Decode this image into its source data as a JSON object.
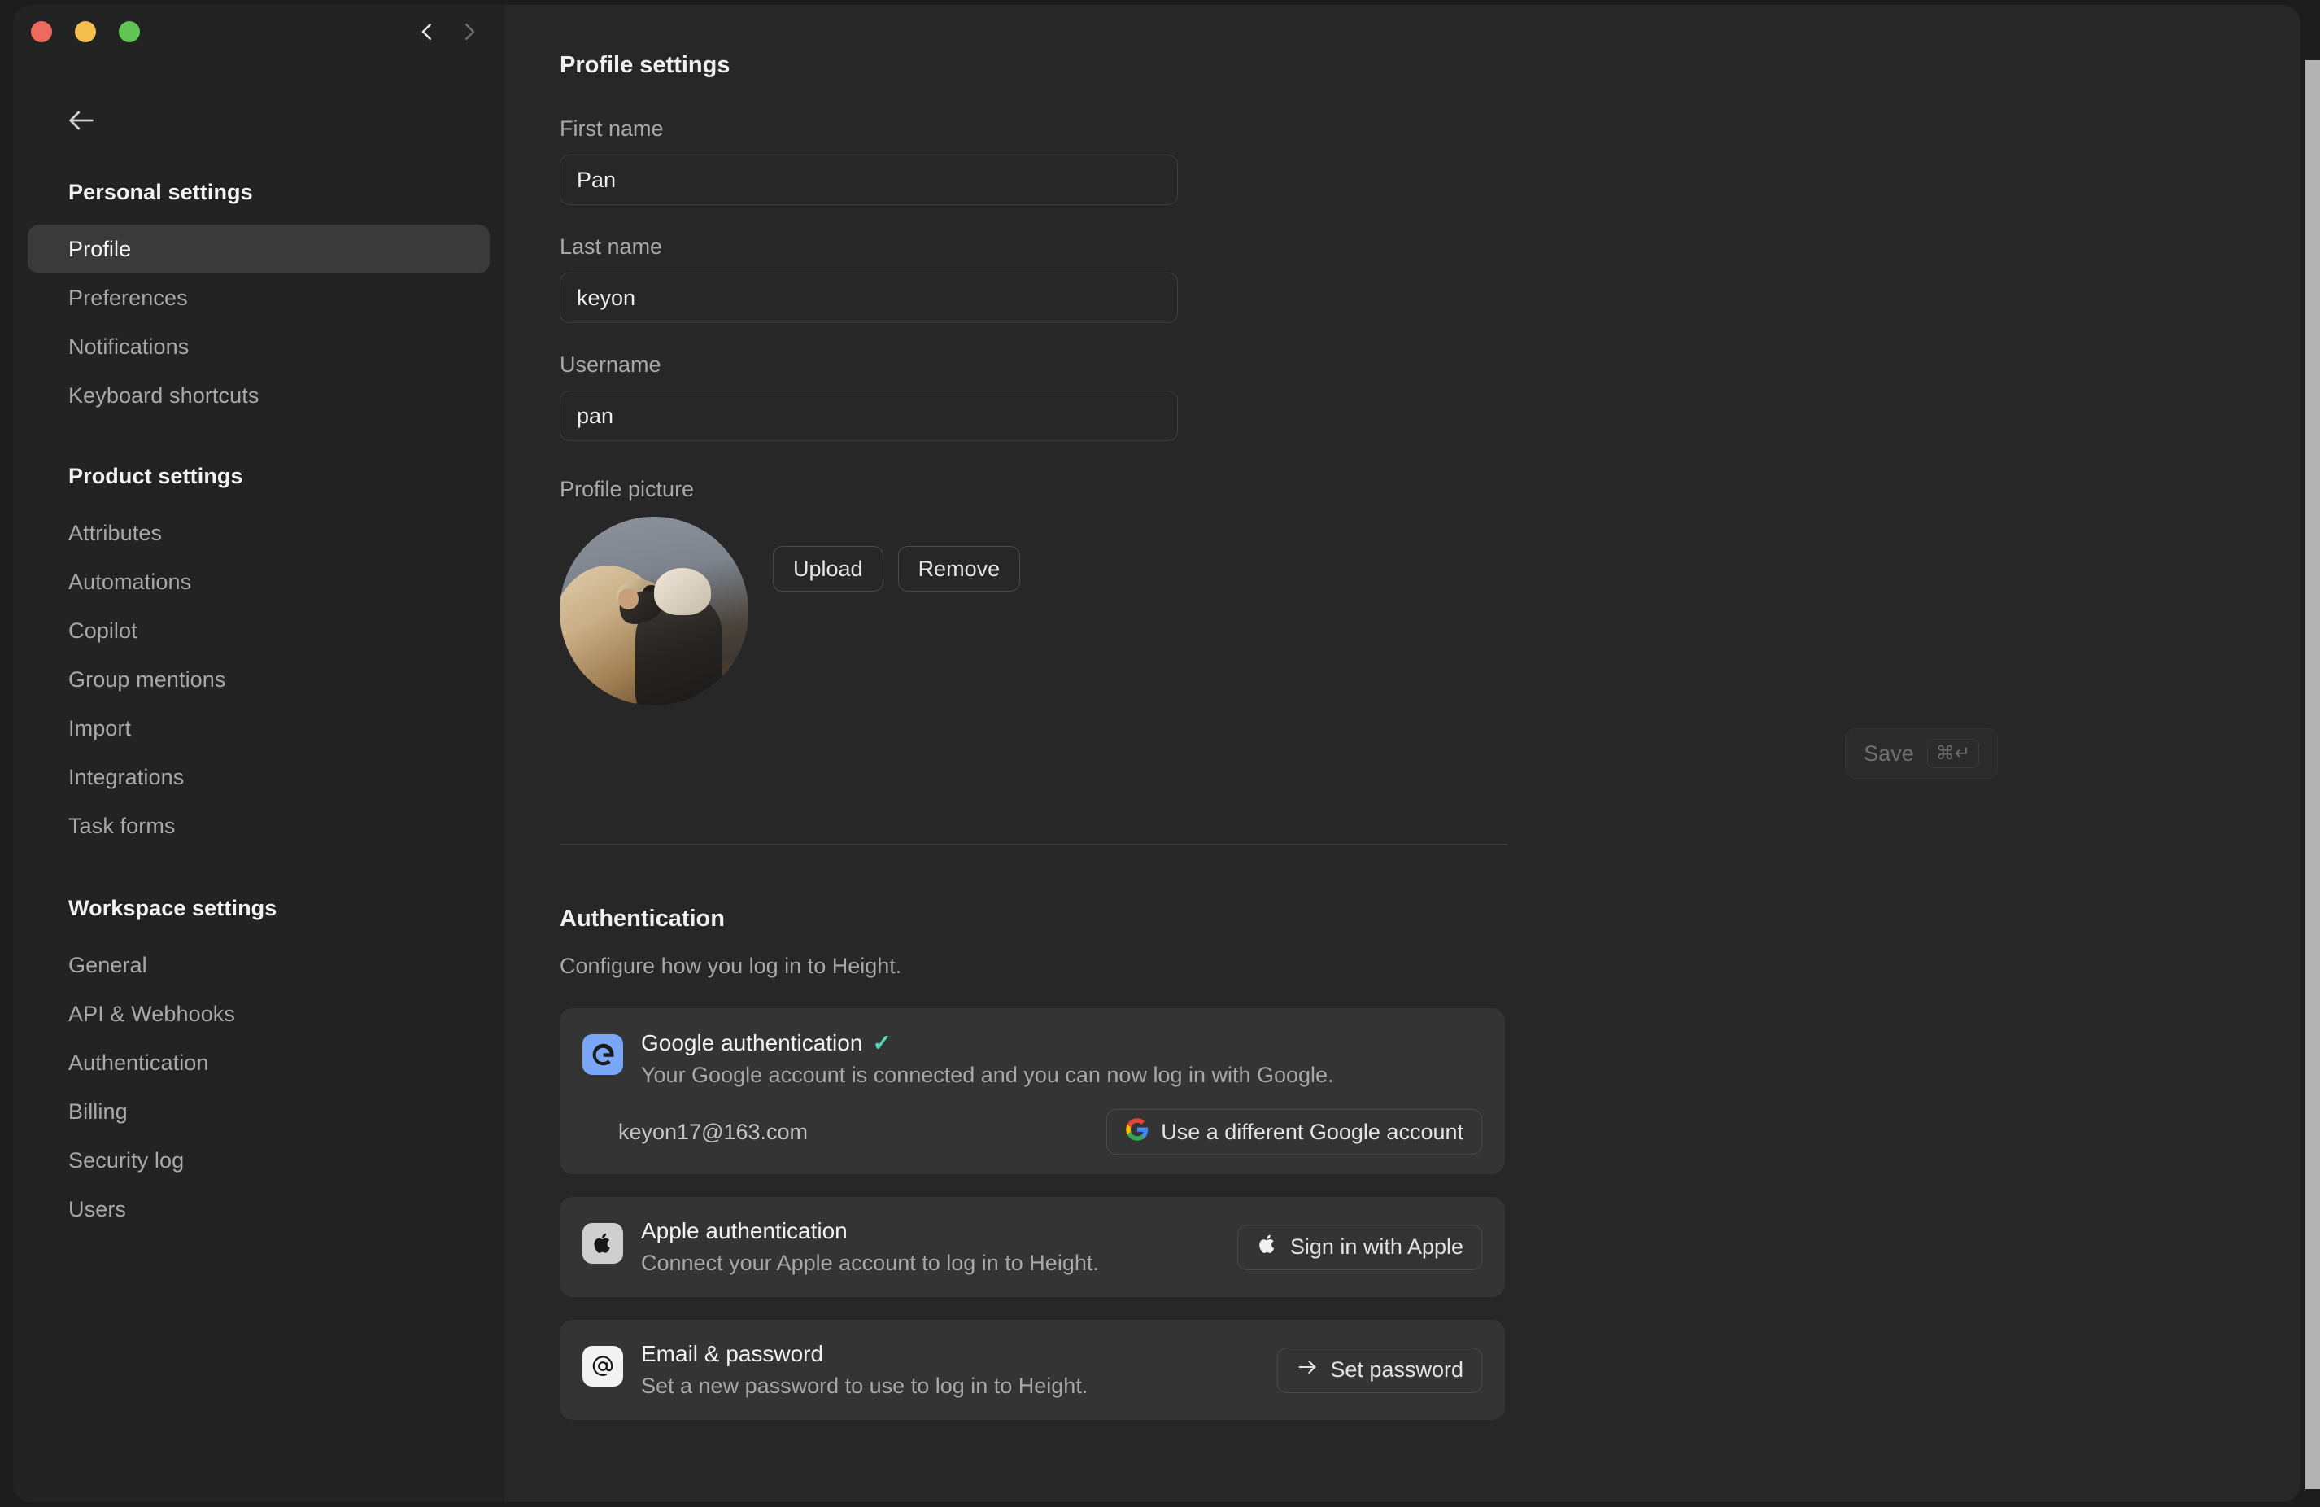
{
  "window": {
    "traffic_lights": [
      "close",
      "minimize",
      "zoom"
    ],
    "nav_back_icon": "chevron-left-icon",
    "nav_forward_icon": "chevron-right-icon",
    "back_arrow_icon": "arrow-left-icon"
  },
  "sidebar": {
    "groups": [
      {
        "title": "Personal settings",
        "items": [
          {
            "label": "Profile",
            "active": true
          },
          {
            "label": "Preferences",
            "active": false
          },
          {
            "label": "Notifications",
            "active": false
          },
          {
            "label": "Keyboard shortcuts",
            "active": false
          }
        ]
      },
      {
        "title": "Product settings",
        "items": [
          {
            "label": "Attributes",
            "active": false
          },
          {
            "label": "Automations",
            "active": false
          },
          {
            "label": "Copilot",
            "active": false
          },
          {
            "label": "Group mentions",
            "active": false
          },
          {
            "label": "Import",
            "active": false
          },
          {
            "label": "Integrations",
            "active": false
          },
          {
            "label": "Task forms",
            "active": false
          }
        ]
      },
      {
        "title": "Workspace settings",
        "items": [
          {
            "label": "General",
            "active": false
          },
          {
            "label": "API & Webhooks",
            "active": false
          },
          {
            "label": "Authentication",
            "active": false
          },
          {
            "label": "Billing",
            "active": false
          },
          {
            "label": "Security log",
            "active": false
          },
          {
            "label": "Users",
            "active": false
          }
        ]
      }
    ]
  },
  "profile": {
    "title": "Profile settings",
    "fields": [
      {
        "label": "First name",
        "value": "Pan"
      },
      {
        "label": "Last name",
        "value": "keyon"
      },
      {
        "label": "Username",
        "value": "pan"
      }
    ],
    "picture": {
      "label": "Profile picture",
      "alt": "photo of a child and a dog",
      "upload_label": "Upload",
      "remove_label": "Remove"
    },
    "save": {
      "label": "Save",
      "shortcut": "⌘↵",
      "enabled": false
    }
  },
  "authentication": {
    "title": "Authentication",
    "subtitle": "Configure how you log in to Height.",
    "cards": [
      {
        "id": "google",
        "icon": "google-g-icon",
        "icon_bg": "#7aa6f7",
        "name": "Google authentication",
        "connected": true,
        "check_glyph": "✓",
        "check_color": "#4fd7c0",
        "description": "Your Google account is connected and you can now log in with Google.",
        "email": "keyon17@163.com",
        "action_label": "Use a different Google account",
        "action_icon": "google-color-icon"
      },
      {
        "id": "apple",
        "icon": "apple-icon",
        "icon_bg": "#cfcfcf",
        "name": "Apple authentication",
        "connected": false,
        "description": "Connect your Apple account to log in to Height.",
        "action_label": "Sign in with Apple",
        "action_icon": "apple-icon"
      },
      {
        "id": "email",
        "icon": "at-sign-icon",
        "icon_bg": "#f2f2f2",
        "name": "Email & password",
        "connected": false,
        "description": "Set a new password to use to log in to Height.",
        "action_label": "Set password",
        "action_icon": "arrow-right-icon"
      }
    ]
  },
  "colors": {
    "window_bg": "#272727",
    "sidebar_bg": "#232323",
    "card_bg": "#343434",
    "active_nav_bg": "#3a3a3a",
    "text_primary": "#f2f2f2",
    "text_muted": "#a8a8a8",
    "border": "#4a4a4a",
    "accent_check": "#4fd7c0",
    "scrollbar": "#b3b3b3"
  }
}
